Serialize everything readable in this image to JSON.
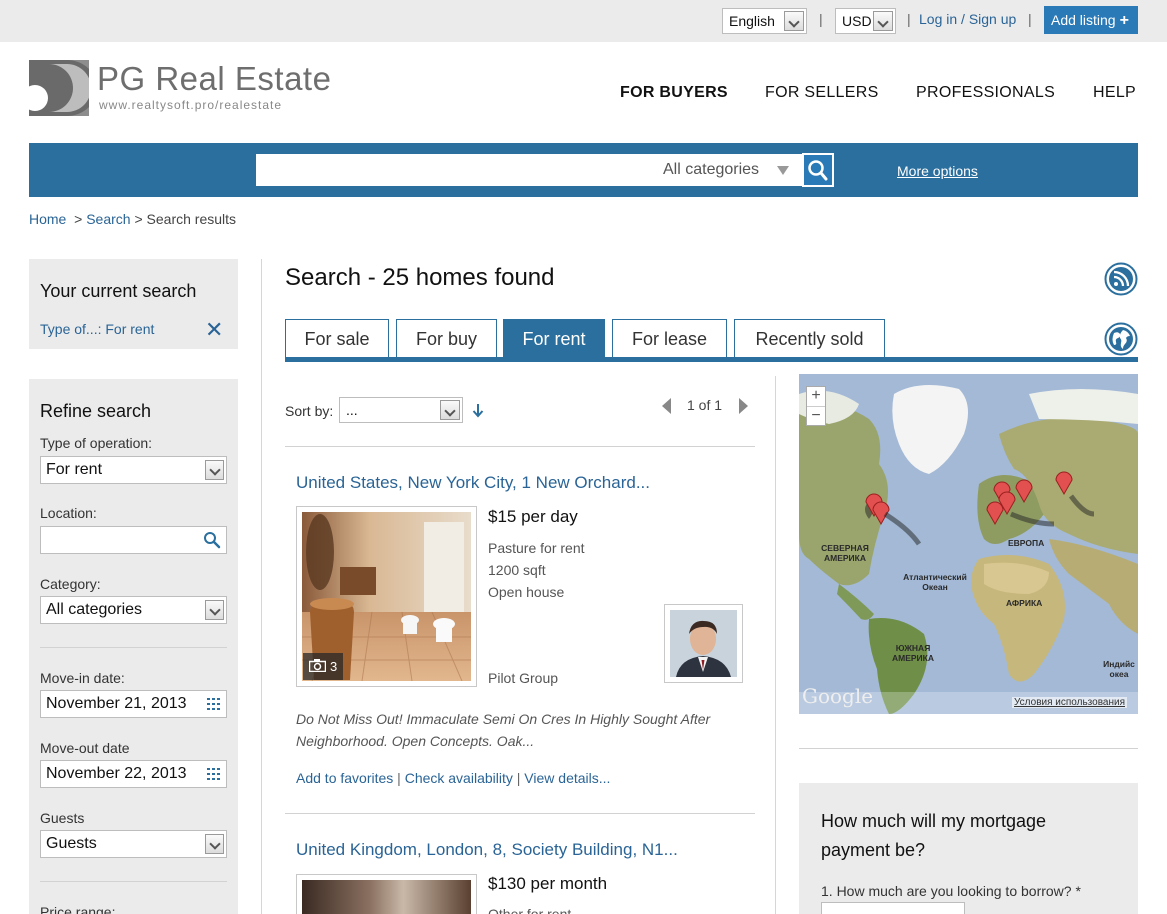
{
  "topbar": {
    "language": "English",
    "currency": "USD",
    "separator": "|",
    "login_label": "Log in / Sign up",
    "add_listing_label": "Add listing",
    "add_listing_plus": "+"
  },
  "logo": {
    "title": "PG Real Estate",
    "subtitle": "www.realtysoft.pro/realestate"
  },
  "nav": {
    "items": [
      "FOR BUYERS",
      "FOR SELLERS",
      "PROFESSIONALS",
      "HELP"
    ]
  },
  "search": {
    "category": "All categories",
    "more_options": "More options"
  },
  "breadcrumb": {
    "home": "Home",
    "sep": ">",
    "search": "Search",
    "current": "Search results"
  },
  "current_search": {
    "title": "Your current search",
    "filter": "Type of...: For rent",
    "remove_glyph": "✕"
  },
  "refine": {
    "title": "Refine search",
    "operation_label": "Type of operation:",
    "operation_value": "For rent",
    "location_label": "Location:",
    "category_label": "Category:",
    "category_value": "All categories",
    "movein_label": "Move-in date:",
    "movein_value": "November 21, 2013",
    "moveout_label": "Move-out date",
    "moveout_value": "November 22, 2013",
    "guests_label": "Guests",
    "guests_value": "Guests",
    "price_label": "Price range:"
  },
  "results": {
    "title": "Search - 25 homes found",
    "tabs": [
      "For sale",
      "For buy",
      "For rent",
      "For lease",
      "Recently sold"
    ],
    "active_tab": "For rent",
    "sort_label": "Sort by:",
    "sort_value": "...",
    "pager": "1 of 1"
  },
  "listings": [
    {
      "title": "United States, New York City, 1 New Orchard...",
      "price": "$15 per day",
      "attrs": [
        "Pasture for rent",
        "1200 sqft",
        "Open house"
      ],
      "agent": "Pilot Group",
      "photo_count": "3",
      "description": "Do Not Miss Out! Immaculate Semi On Cres In Highly Sought After Neighborhood. Open Concepts. Oak...",
      "actions": [
        "Add to favorites",
        "Check availability",
        "View details..."
      ],
      "action_sep": "|"
    },
    {
      "title": "United Kingdom, London, 8, Society Building, N1...",
      "price": "$130 per month",
      "attrs": [
        "Other for rent"
      ]
    }
  ],
  "map": {
    "labels": {
      "north_america": "СЕВЕРНАЯ АМЕРИКА",
      "europe": "ЕВРОПА",
      "atlantic": "Атлантический Океан",
      "africa": "АФРИКА",
      "south_america": "ЮЖНАЯ АМЕРИКА",
      "indian": "Индийс океа"
    },
    "google": "Google",
    "terms": "Условия использования",
    "zoom_in": "+",
    "zoom_out": "−"
  },
  "mortgage": {
    "title": "How much will my mortgage payment be?",
    "q1": "1. How much are you looking to borrow? *"
  },
  "colors": {
    "brand_blue": "#2a6f9e",
    "link_blue": "#2a6496",
    "panel_gray": "#ebebeb"
  }
}
